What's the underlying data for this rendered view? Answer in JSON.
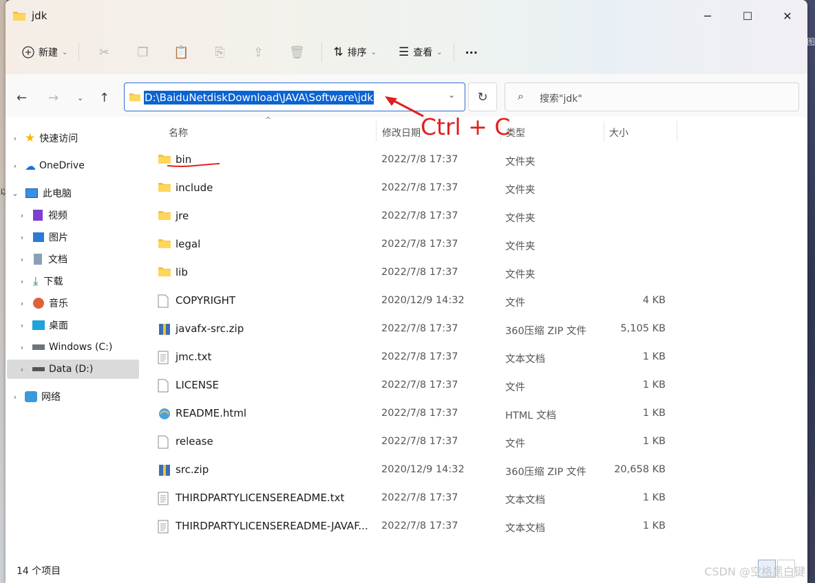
{
  "window": {
    "title": "jdk"
  },
  "toolbar": {
    "new_label": "新建",
    "sort_label": "排序",
    "view_label": "查看",
    "more_label": "···"
  },
  "address": {
    "path": "D:\\BaiduNetdiskDownload\\JAVA\\Software\\jdk"
  },
  "search": {
    "placeholder": "搜索\"jdk\""
  },
  "annotation": {
    "text": "Ctrl + C",
    "color": "#e21e1e"
  },
  "sidebar": {
    "items": [
      {
        "label": "快速访问"
      },
      {
        "label": "OneDrive"
      },
      {
        "label": "此电脑"
      },
      {
        "label": "视频"
      },
      {
        "label": "图片"
      },
      {
        "label": "文档"
      },
      {
        "label": "下载"
      },
      {
        "label": "音乐"
      },
      {
        "label": "桌面"
      },
      {
        "label": "Windows (C:)"
      },
      {
        "label": "Data (D:)"
      },
      {
        "label": "网络"
      }
    ]
  },
  "columns": {
    "name": "名称",
    "date": "修改日期",
    "type": "类型",
    "size": "大小"
  },
  "files": [
    {
      "name": "bin",
      "date": "2022/7/8 17:37",
      "type": "文件夹",
      "size": ""
    },
    {
      "name": "include",
      "date": "2022/7/8 17:37",
      "type": "文件夹",
      "size": ""
    },
    {
      "name": "jre",
      "date": "2022/7/8 17:37",
      "type": "文件夹",
      "size": ""
    },
    {
      "name": "legal",
      "date": "2022/7/8 17:37",
      "type": "文件夹",
      "size": ""
    },
    {
      "name": "lib",
      "date": "2022/7/8 17:37",
      "type": "文件夹",
      "size": ""
    },
    {
      "name": "COPYRIGHT",
      "date": "2020/12/9 14:32",
      "type": "文件",
      "size": "4 KB"
    },
    {
      "name": "javafx-src.zip",
      "date": "2022/7/8 17:37",
      "type": "360压缩 ZIP 文件",
      "size": "5,105 KB"
    },
    {
      "name": "jmc.txt",
      "date": "2022/7/8 17:37",
      "type": "文本文档",
      "size": "1 KB"
    },
    {
      "name": "LICENSE",
      "date": "2022/7/8 17:37",
      "type": "文件",
      "size": "1 KB"
    },
    {
      "name": "README.html",
      "date": "2022/7/8 17:37",
      "type": "HTML 文档",
      "size": "1 KB"
    },
    {
      "name": "release",
      "date": "2022/7/8 17:37",
      "type": "文件",
      "size": "1 KB"
    },
    {
      "name": "src.zip",
      "date": "2020/12/9 14:32",
      "type": "360压缩 ZIP 文件",
      "size": "20,658 KB"
    },
    {
      "name": "THIRDPARTYLICENSEREADME.txt",
      "date": "2022/7/8 17:37",
      "type": "文本文档",
      "size": "1 KB"
    },
    {
      "name": "THIRDPARTYLICENSEREADME-JAVAF...",
      "date": "2022/7/8 17:37",
      "type": "文本文档",
      "size": "1 KB"
    }
  ],
  "status": {
    "count": "14 个项目"
  },
  "watermark": "CSDN @空格黑白键"
}
